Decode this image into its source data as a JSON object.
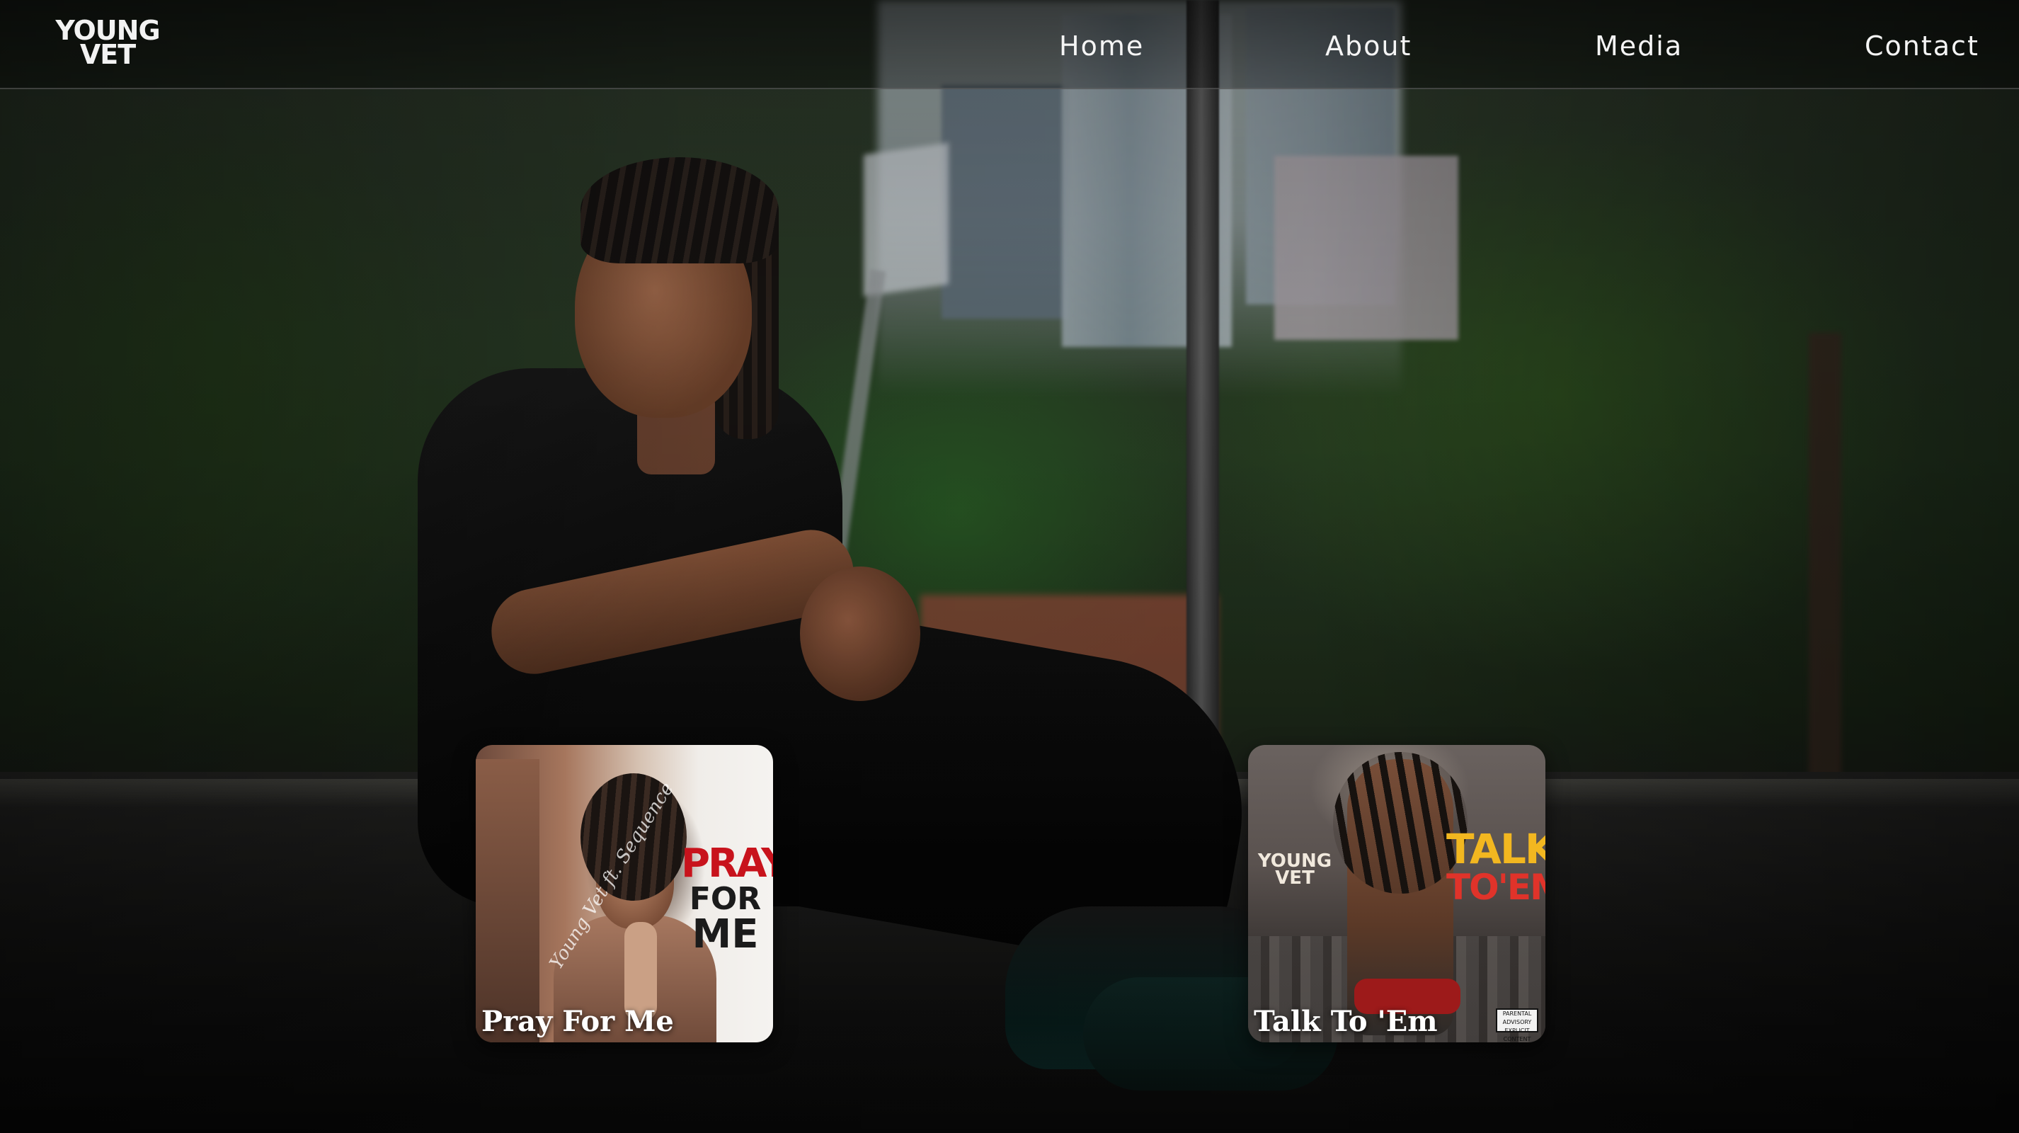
{
  "brand": {
    "logo_line1": "YOUNG",
    "logo_line2": "VET"
  },
  "nav": {
    "items": [
      {
        "label": "Home"
      },
      {
        "label": "About"
      },
      {
        "label": "Media"
      },
      {
        "label": "Contact"
      }
    ]
  },
  "releases": [
    {
      "title": "Pray For Me",
      "cover_text": {
        "main": "PRAY",
        "line2": "FOR",
        "line3": "ME",
        "script": "Young Vet ft. Sequence"
      }
    },
    {
      "title": "Talk To 'Em",
      "cover_text": {
        "artist_line1": "YOUNG",
        "artist_line2": "VET",
        "main": "TALK",
        "line2": "TO'EM",
        "advisory": "PARENTAL ADVISORY EXPLICIT CONTENT"
      }
    }
  ],
  "colors": {
    "nav_text": "#f5f5f5",
    "card_title": "#ffffff",
    "pray_red": "#c8131c",
    "talk_yellow": "#f2b720",
    "talk_red": "#e0332a"
  },
  "icons": {
    "logo": "young-vet-logo"
  }
}
